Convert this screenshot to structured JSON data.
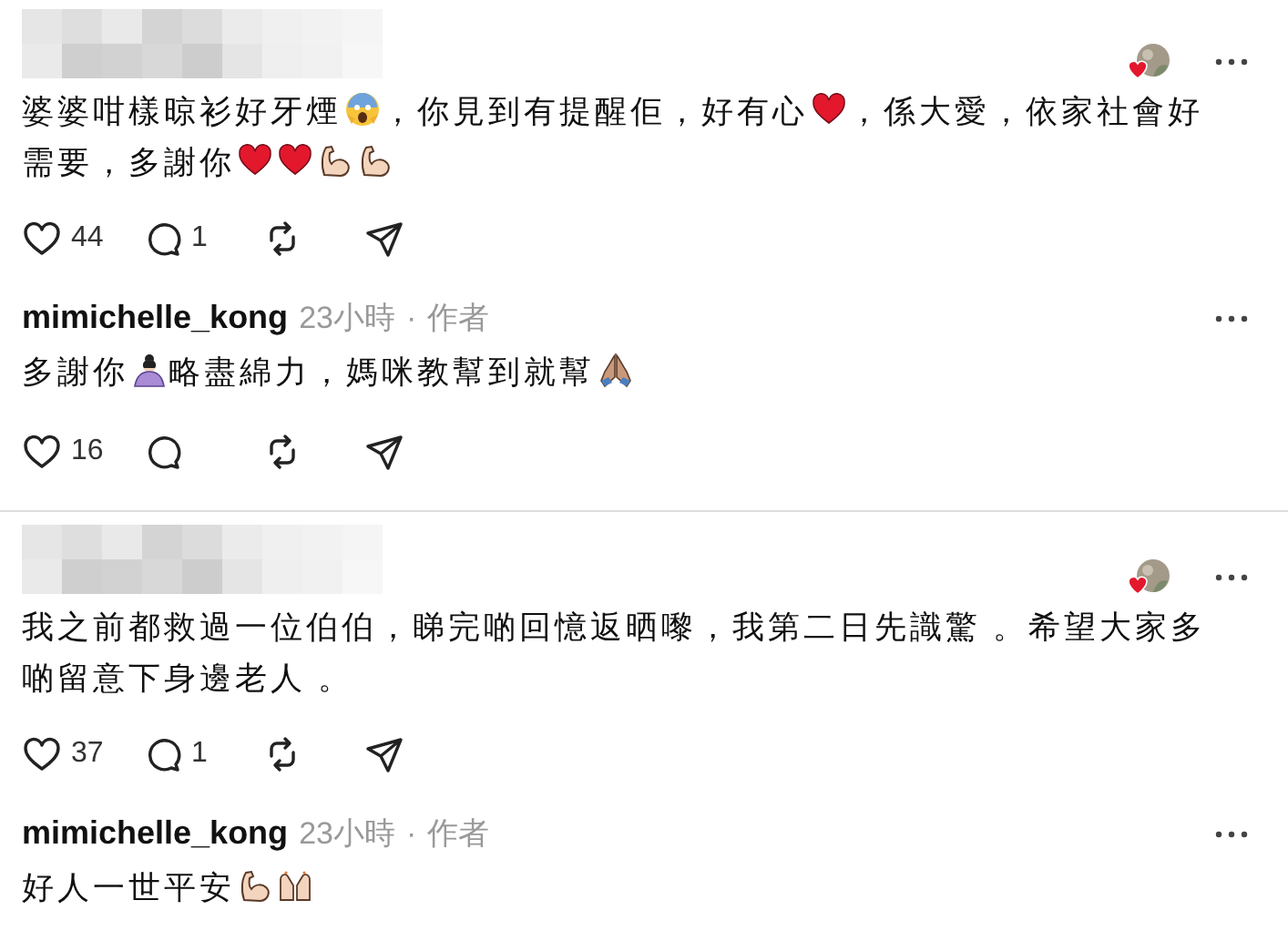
{
  "threads": [
    {
      "comment": {
        "liked_by_author": true,
        "body": [
          {
            "kind": "text",
            "text": "婆婆咁樣晾衫好牙煙"
          },
          {
            "kind": "scream"
          },
          {
            "kind": "text",
            "text": "，你見到有提醒佢，好有心"
          },
          {
            "kind": "heart"
          },
          {
            "kind": "text",
            "text": "，係大愛，依家社會好需要，多謝你"
          },
          {
            "kind": "heart"
          },
          {
            "kind": "heart"
          },
          {
            "kind": "muscle"
          },
          {
            "kind": "muscle"
          }
        ],
        "likes": "44",
        "replies": "1"
      },
      "reply": {
        "author": "mimichelle_kong",
        "time": "23小時",
        "dot": "·",
        "badge": "作者",
        "body": [
          {
            "kind": "text",
            "text": "多謝你"
          },
          {
            "kind": "bow"
          },
          {
            "kind": "text",
            "text": "略盡綿力，媽咪教幫到就幫"
          },
          {
            "kind": "pray"
          }
        ],
        "likes": "16"
      }
    },
    {
      "comment": {
        "liked_by_author": true,
        "body": [
          {
            "kind": "text",
            "text": "我之前都救過一位伯伯，睇完啲回憶返晒嚟，我第二日先識驚 。希望大家多啲留意下身邊老人 。"
          }
        ],
        "likes": "37",
        "replies": "1"
      },
      "reply": {
        "author": "mimichelle_kong",
        "time": "23小時",
        "dot": "·",
        "badge": "作者",
        "body": [
          {
            "kind": "text",
            "text": "好人一世平安"
          },
          {
            "kind": "muscle"
          },
          {
            "kind": "raise"
          }
        ]
      }
    }
  ]
}
